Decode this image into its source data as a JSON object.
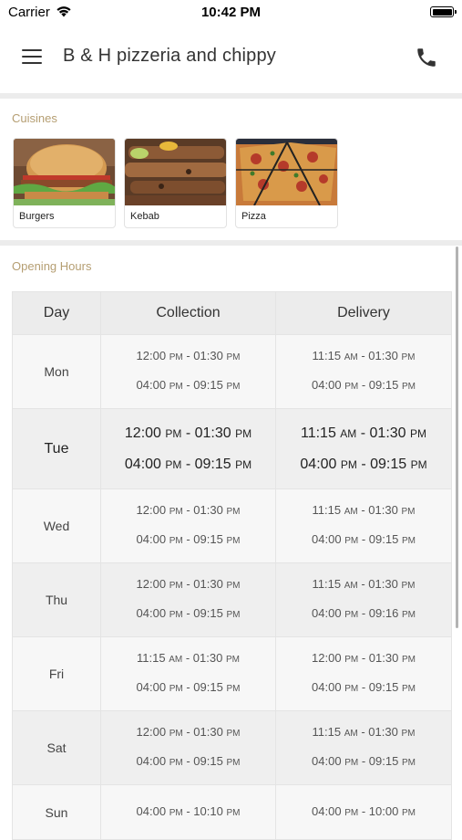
{
  "status_bar": {
    "carrier": "Carrier",
    "time": "10:42 PM"
  },
  "header": {
    "title": "B & H pizzeria and chippy"
  },
  "icons": {
    "menu": "hamburger-menu-icon",
    "phone": "phone-icon",
    "wifi": "wifi-icon",
    "battery": "battery-icon"
  },
  "cuisines": {
    "title": "Cuisines",
    "items": [
      {
        "label": "Burgers"
      },
      {
        "label": "Kebab"
      },
      {
        "label": "Pizza"
      }
    ]
  },
  "opening_hours": {
    "title": "Opening Hours",
    "columns": {
      "day": "Day",
      "collection": "Collection",
      "delivery": "Delivery"
    },
    "rows": [
      {
        "day": "Mon",
        "collection": [
          [
            "12:00",
            "PM",
            "01:30",
            "PM"
          ],
          [
            "04:00",
            "PM",
            "09:15",
            "PM"
          ]
        ],
        "delivery": [
          [
            "11:15",
            "AM",
            "01:30",
            "PM"
          ],
          [
            "04:00",
            "PM",
            "09:15",
            "PM"
          ]
        ]
      },
      {
        "day": "Tue",
        "collection": [
          [
            "12:00",
            "PM",
            "01:30",
            "PM"
          ],
          [
            "04:00",
            "PM",
            "09:15",
            "PM"
          ]
        ],
        "delivery": [
          [
            "11:15",
            "AM",
            "01:30",
            "PM"
          ],
          [
            "04:00",
            "PM",
            "09:15",
            "PM"
          ]
        ]
      },
      {
        "day": "Wed",
        "collection": [
          [
            "12:00",
            "PM",
            "01:30",
            "PM"
          ],
          [
            "04:00",
            "PM",
            "09:15",
            "PM"
          ]
        ],
        "delivery": [
          [
            "11:15",
            "AM",
            "01:30",
            "PM"
          ],
          [
            "04:00",
            "PM",
            "09:15",
            "PM"
          ]
        ]
      },
      {
        "day": "Thu",
        "collection": [
          [
            "12:00",
            "PM",
            "01:30",
            "PM"
          ],
          [
            "04:00",
            "PM",
            "09:15",
            "PM"
          ]
        ],
        "delivery": [
          [
            "11:15",
            "AM",
            "01:30",
            "PM"
          ],
          [
            "04:00",
            "PM",
            "09:16",
            "PM"
          ]
        ]
      },
      {
        "day": "Fri",
        "collection": [
          [
            "11:15",
            "AM",
            "01:30",
            "PM"
          ],
          [
            "04:00",
            "PM",
            "09:15",
            "PM"
          ]
        ],
        "delivery": [
          [
            "12:00",
            "PM",
            "01:30",
            "PM"
          ],
          [
            "04:00",
            "PM",
            "09:15",
            "PM"
          ]
        ]
      },
      {
        "day": "Sat",
        "collection": [
          [
            "12:00",
            "PM",
            "01:30",
            "PM"
          ],
          [
            "04:00",
            "PM",
            "09:15",
            "PM"
          ]
        ],
        "delivery": [
          [
            "11:15",
            "AM",
            "01:30",
            "PM"
          ],
          [
            "04:00",
            "PM",
            "09:15",
            "PM"
          ]
        ]
      },
      {
        "day": "Sun",
        "collection": [
          [
            "04:00",
            "PM",
            "10:10",
            "PM"
          ]
        ],
        "delivery": [
          [
            "04:00",
            "PM",
            "10:00",
            "PM"
          ]
        ]
      }
    ]
  },
  "colors": {
    "section_title": "#b59e72",
    "divider": "#ececec",
    "header_cell": "#ececec"
  }
}
